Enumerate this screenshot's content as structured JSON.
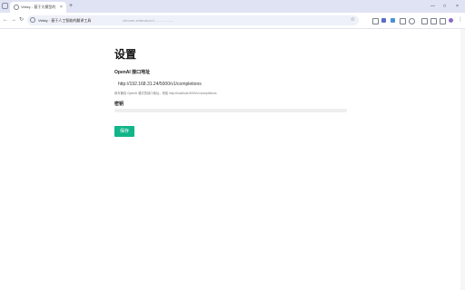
{
  "browser": {
    "tab_title": "Vekky - 基于大模型的",
    "tab_close": "×",
    "new_tab": "+",
    "url_prefix": "Vekky · 基于人工智能的翻译工具",
    "url_rest": "chrome-extension://...................",
    "icons": [
      "window-icon",
      "back-icon",
      "forward-icon",
      "reload-icon",
      "site-info-icon",
      "star-icon",
      "extensions-icon",
      "menu-icon"
    ],
    "window_controls": [
      "—",
      "□",
      "×"
    ]
  },
  "settings": {
    "title": "设置",
    "endpoint_label": "OpenAI 接口地址",
    "endpoint_value": "http://192.168.31.24/5000/v1/completions",
    "endpoint_hint": "填写兼容 OpenAI 格式的接口地址，例如 http://localhost:5000/v1/completions",
    "key_label": "密钥",
    "key_value": "",
    "save_label": "保存"
  },
  "colors": {
    "accent": "#10b58a",
    "tabstrip": "#dfe3f3",
    "omnibox": "#eef1f8"
  }
}
